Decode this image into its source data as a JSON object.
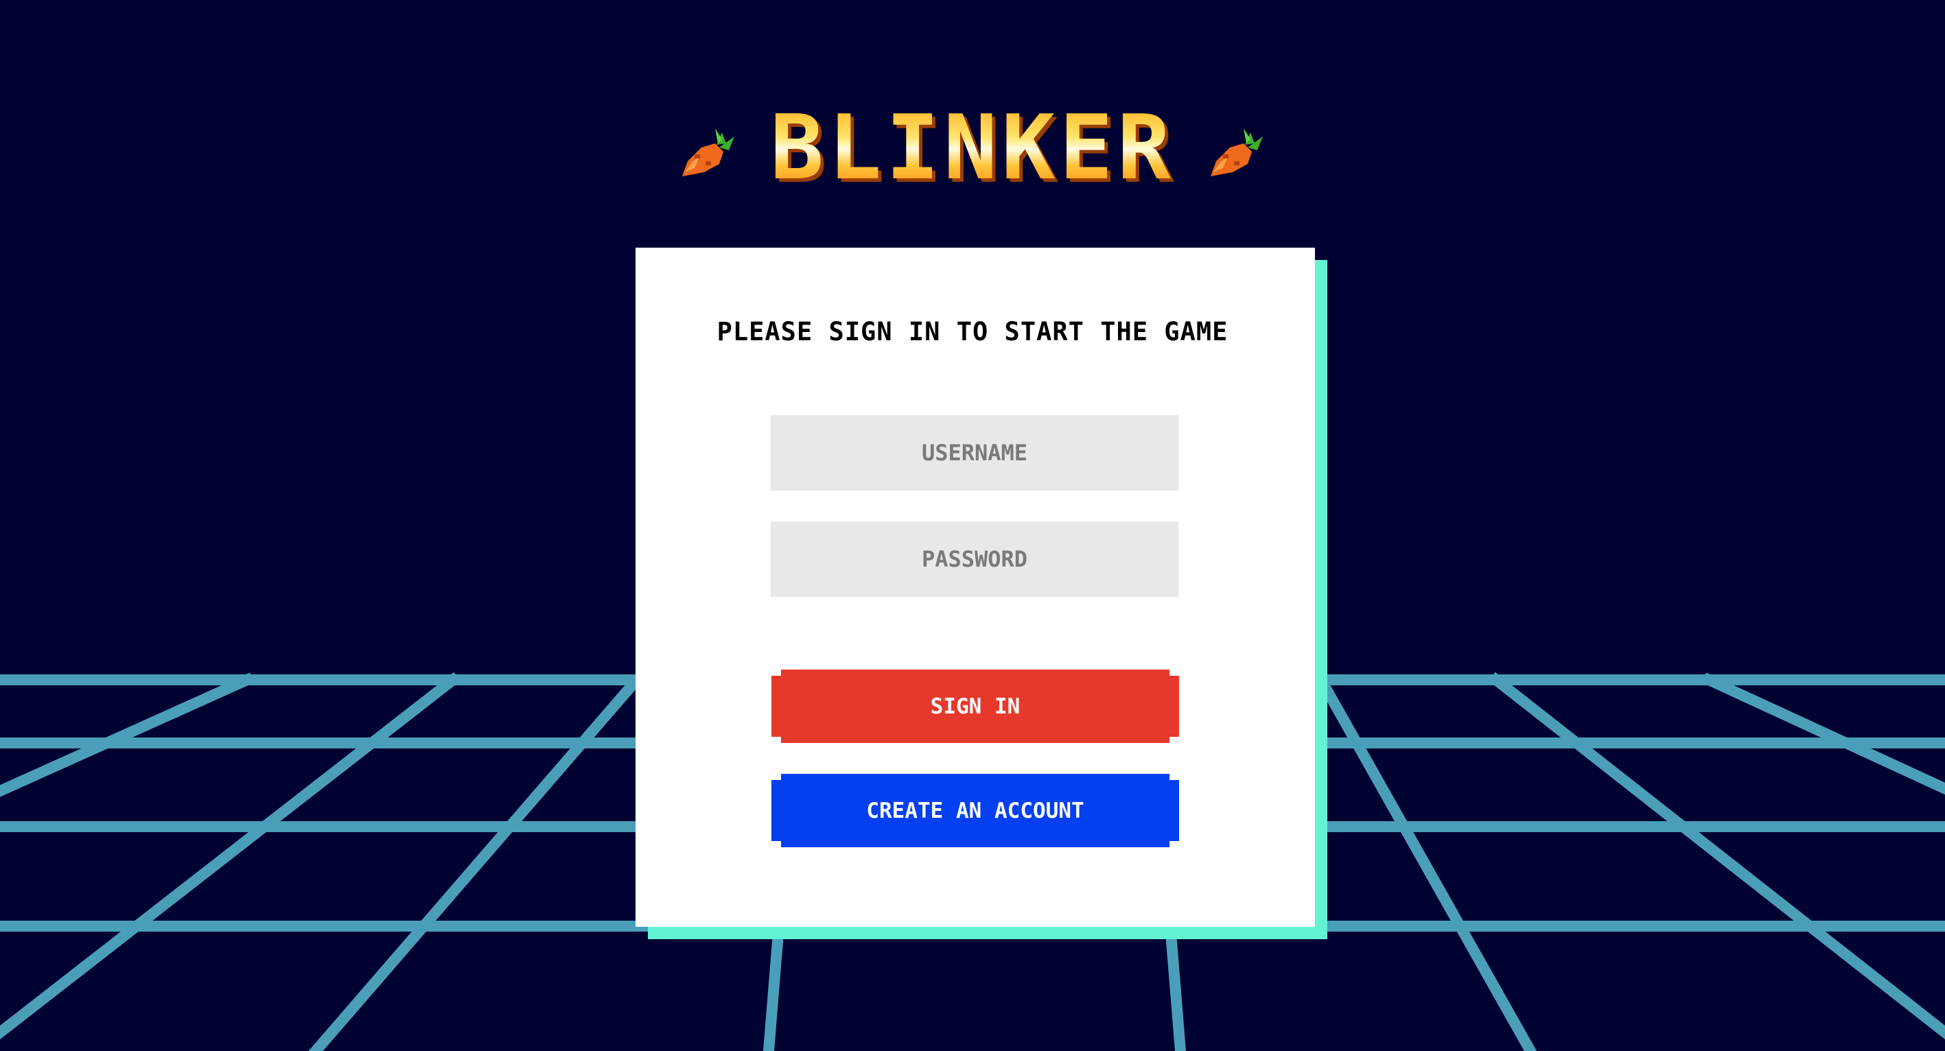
{
  "app": {
    "title": "BLINKER",
    "title_icon_left": "carrot-icon",
    "title_icon_right": "carrot-icon"
  },
  "login_card": {
    "heading": "PLEASE SIGN IN TO START THE GAME",
    "username_placeholder": "USERNAME",
    "password_placeholder": "PASSWORD",
    "username_value": "",
    "password_value": "",
    "signin_label": "SIGN IN",
    "create_account_label": "CREATE AN ACCOUNT"
  },
  "colors": {
    "background": "#000231",
    "grid_line": "#4a9eb8",
    "card": "#ffffff",
    "card_shadow": "#64f2d4",
    "signin_button": "#e7392b",
    "create_button": "#0440f0",
    "input_background": "#e8e8e8",
    "title_gold": "#ffbf3c"
  }
}
